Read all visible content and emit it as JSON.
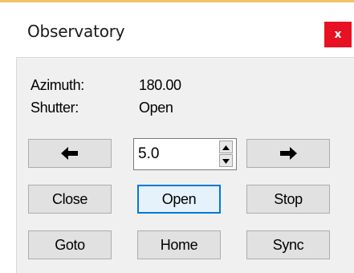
{
  "window": {
    "title": "Observatory",
    "close_glyph": "x",
    "accent_color": "#f0c267",
    "close_color": "#e81123",
    "focus_color": "#0078d7"
  },
  "status": {
    "azimuth_label": "Azimuth:",
    "azimuth_value": "180.00",
    "shutter_label": "Shutter:",
    "shutter_value": "Open"
  },
  "controls": {
    "left_icon": "arrow-left-icon",
    "right_icon": "arrow-right-icon",
    "step_value": "5.0",
    "spin_up_icon": "spin-up-icon",
    "spin_down_icon": "spin-down-icon",
    "close_label": "Close",
    "open_label": "Open",
    "stop_label": "Stop",
    "goto_label": "Goto",
    "home_label": "Home",
    "sync_label": "Sync"
  }
}
